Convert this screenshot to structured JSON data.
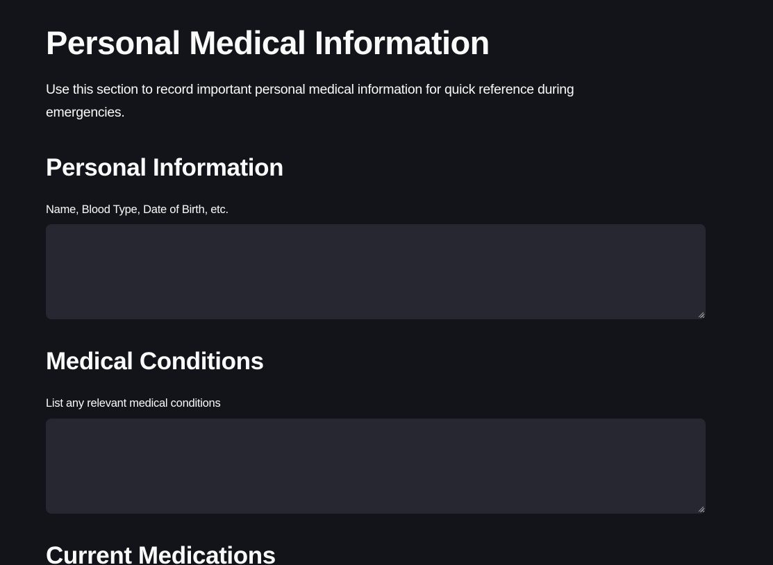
{
  "page": {
    "title": "Personal Medical Information",
    "intro": "Use this section to record important personal medical information for quick reference during emergencies."
  },
  "sections": [
    {
      "heading": "Personal Information",
      "field_label": "Name, Blood Type, Date of Birth, etc.",
      "value": ""
    },
    {
      "heading": "Medical Conditions",
      "field_label": "List any relevant medical conditions",
      "value": ""
    },
    {
      "heading": "Current Medications"
    }
  ],
  "colors": {
    "background": "#131419",
    "input_background": "#262730",
    "text": "#fafafa"
  },
  "icons": {
    "resize_handle": "resize-grip-icon"
  }
}
